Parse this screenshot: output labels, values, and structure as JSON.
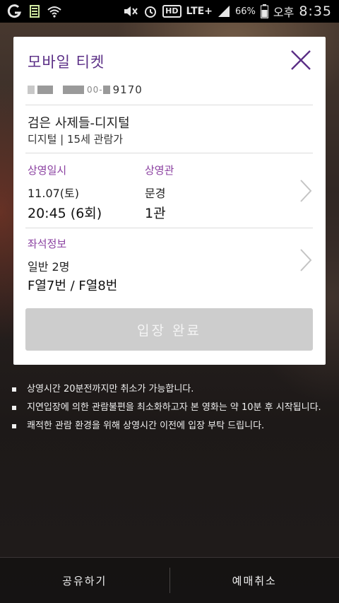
{
  "status_bar": {
    "battery": "66%",
    "ampm": "오후",
    "time": "8:35",
    "network": "LTE+",
    "hd": "HD"
  },
  "ticket": {
    "title": "모바일 티켓",
    "booking_number_suffix": "9170",
    "booking_number_mid": "00-",
    "movie_title": "검은 사제들-디지털",
    "movie_sub": "디지털 | 15세 관람가",
    "showtime_label": "상영일시",
    "showtime_date": "11.07(토)",
    "showtime_time": "20:45 (6회)",
    "theater_label": "상영관",
    "theater_name": "문경",
    "theater_hall": "1관",
    "seat_label": "좌석정보",
    "seat_type": "일반 2명",
    "seat_numbers": "F열7번 / F열8번",
    "enter_button": "입장 완료"
  },
  "notices": [
    "상영시간 20분전까지만 취소가 가능합니다.",
    "지연입장에 의한 관람불편을 최소화하고자 본 영화는 약 10분 후 시작됩니다.",
    "쾌적한 관람 환경을 위해 상영시간 이전에 입장 부탁 드립니다."
  ],
  "bottom_bar": {
    "share": "공유하기",
    "cancel": "예매취소"
  },
  "colors": {
    "accent": "#5b2f86",
    "label": "#8a3fa0",
    "disabled_button": "#cdcdcd"
  }
}
